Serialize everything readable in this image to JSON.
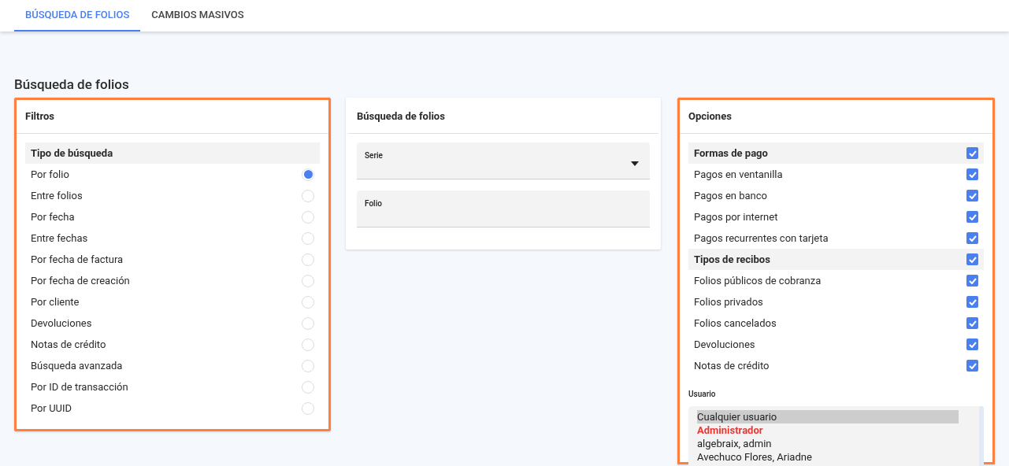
{
  "tabs": [
    {
      "label": "BÚSQUEDA DE FOLIOS",
      "selected": true
    },
    {
      "label": "CAMBIOS MASIVOS",
      "selected": false
    }
  ],
  "page_title": "Búsqueda de folios",
  "filters": {
    "title": "Filtros",
    "highlighted": true,
    "items": [
      {
        "kind": "header",
        "label": "Tipo de búsqueda"
      },
      {
        "kind": "option",
        "label": "Por folio",
        "selected": true
      },
      {
        "kind": "option",
        "label": "Entre folios",
        "selected": false
      },
      {
        "kind": "option",
        "label": "Por fecha",
        "selected": false
      },
      {
        "kind": "option",
        "label": "Entre fechas",
        "selected": false
      },
      {
        "kind": "option",
        "label": "Por fecha de factura",
        "selected": false
      },
      {
        "kind": "option",
        "label": "Por fecha de creación",
        "selected": false
      },
      {
        "kind": "option",
        "label": "Por cliente",
        "selected": false
      },
      {
        "kind": "option",
        "label": "Devoluciones",
        "selected": false
      },
      {
        "kind": "option",
        "label": "Notas de crédito",
        "selected": false
      },
      {
        "kind": "option",
        "label": "Búsqueda avanzada",
        "selected": false
      },
      {
        "kind": "option",
        "label": "Por ID de transacción",
        "selected": false
      },
      {
        "kind": "option",
        "label": "Por UUID",
        "selected": false
      }
    ]
  },
  "search": {
    "title": "Búsqueda de folios",
    "highlighted": false,
    "fields": [
      {
        "kind": "select",
        "label": "Serie"
      },
      {
        "kind": "text",
        "label": "Folio"
      }
    ]
  },
  "options": {
    "title": "Opciones",
    "highlighted": true,
    "items": [
      {
        "kind": "header",
        "label": "Formas de pago",
        "checked": true
      },
      {
        "kind": "option",
        "label": "Pagos en ventanilla",
        "checked": true
      },
      {
        "kind": "option",
        "label": "Pagos en banco",
        "checked": true
      },
      {
        "kind": "option",
        "label": "Pagos por internet",
        "checked": true
      },
      {
        "kind": "option",
        "label": "Pagos recurrentes con tarjeta",
        "checked": true
      },
      {
        "kind": "header",
        "label": "Tipos de recibos",
        "checked": true
      },
      {
        "kind": "option",
        "label": "Folios públicos de cobranza",
        "checked": true
      },
      {
        "kind": "option",
        "label": "Folios privados",
        "checked": true
      },
      {
        "kind": "option",
        "label": "Folios cancelados",
        "checked": true
      },
      {
        "kind": "option",
        "label": "Devoluciones",
        "checked": true
      },
      {
        "kind": "option",
        "label": "Notas de crédito",
        "checked": true
      }
    ],
    "user": {
      "label": "Usuario",
      "items": [
        {
          "kind": "option",
          "label": "Cualquier usuario",
          "selected": true
        },
        {
          "kind": "group",
          "label": "Administrador",
          "selected": false
        },
        {
          "kind": "option",
          "label": "algebraix, admin",
          "selected": false
        },
        {
          "kind": "option",
          "label": "Avechuco Flores, Ariadne",
          "selected": false
        }
      ]
    }
  }
}
